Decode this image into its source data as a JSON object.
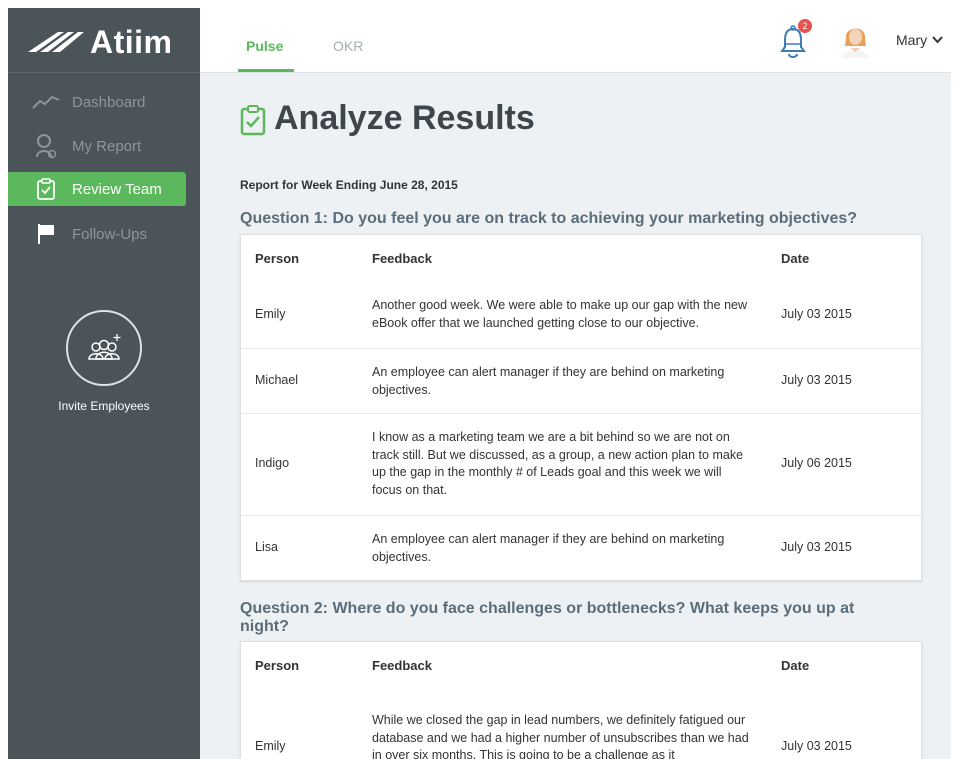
{
  "brand": {
    "name": "Atiim"
  },
  "sidebar": {
    "items": [
      {
        "label": "Dashboard",
        "icon": "chart-line-icon"
      },
      {
        "label": "My Report",
        "icon": "person-report-icon"
      },
      {
        "label": "Review Team",
        "icon": "clipboard-check-icon",
        "active": true
      },
      {
        "label": "Follow-Ups",
        "icon": "flag-icon"
      }
    ],
    "invite_label": "Invite Employees"
  },
  "topbar": {
    "tabs": [
      {
        "label": "Pulse",
        "active": true
      },
      {
        "label": "OKR",
        "active": false
      }
    ],
    "notification_count": "2",
    "user_name": "Mary"
  },
  "page": {
    "title": "Analyze Results",
    "report_label": "Report for Week Ending June 28, 2015"
  },
  "table_headers": {
    "person": "Person",
    "feedback": "Feedback",
    "date": "Date"
  },
  "questions": [
    {
      "title": "Question 1: Do you feel you are on track to achieving your marketing objectives?",
      "rows": [
        {
          "person": "Emily",
          "feedback": "Another good week. We were able to make up our gap with the new eBook offer that we launched getting close to our objective.",
          "date": "July 03 2015"
        },
        {
          "person": "Michael",
          "feedback": "An employee can alert manager if they are behind on marketing objectives.",
          "date": "July 03 2015"
        },
        {
          "person": "Indigo",
          "feedback": "I know as a marketing team we are a bit behind so we are not on track still. But we discussed, as a group, a new action plan to make up the gap in the monthly # of Leads goal and this week we will focus on that.",
          "date": "July 06 2015"
        },
        {
          "person": "Lisa",
          "feedback": "An employee can alert manager if they are behind on marketing objectives.",
          "date": "July 03 2015"
        }
      ]
    },
    {
      "title": "Question 2: Where do you face challenges or bottlenecks? What keeps you up at night?",
      "rows": [
        {
          "person": "Emily",
          "feedback": "While we closed the gap in lead numbers, we definitely fatigued our database and we had a higher number of unsubscribes than we had in over six months. This is going to be a challenge as it",
          "date": "July 03 2015"
        }
      ]
    }
  ],
  "colors": {
    "sidebar": "#4a5459",
    "accent": "#5cb85c",
    "badge": "#e8534f",
    "question": "#5a6d7b"
  }
}
